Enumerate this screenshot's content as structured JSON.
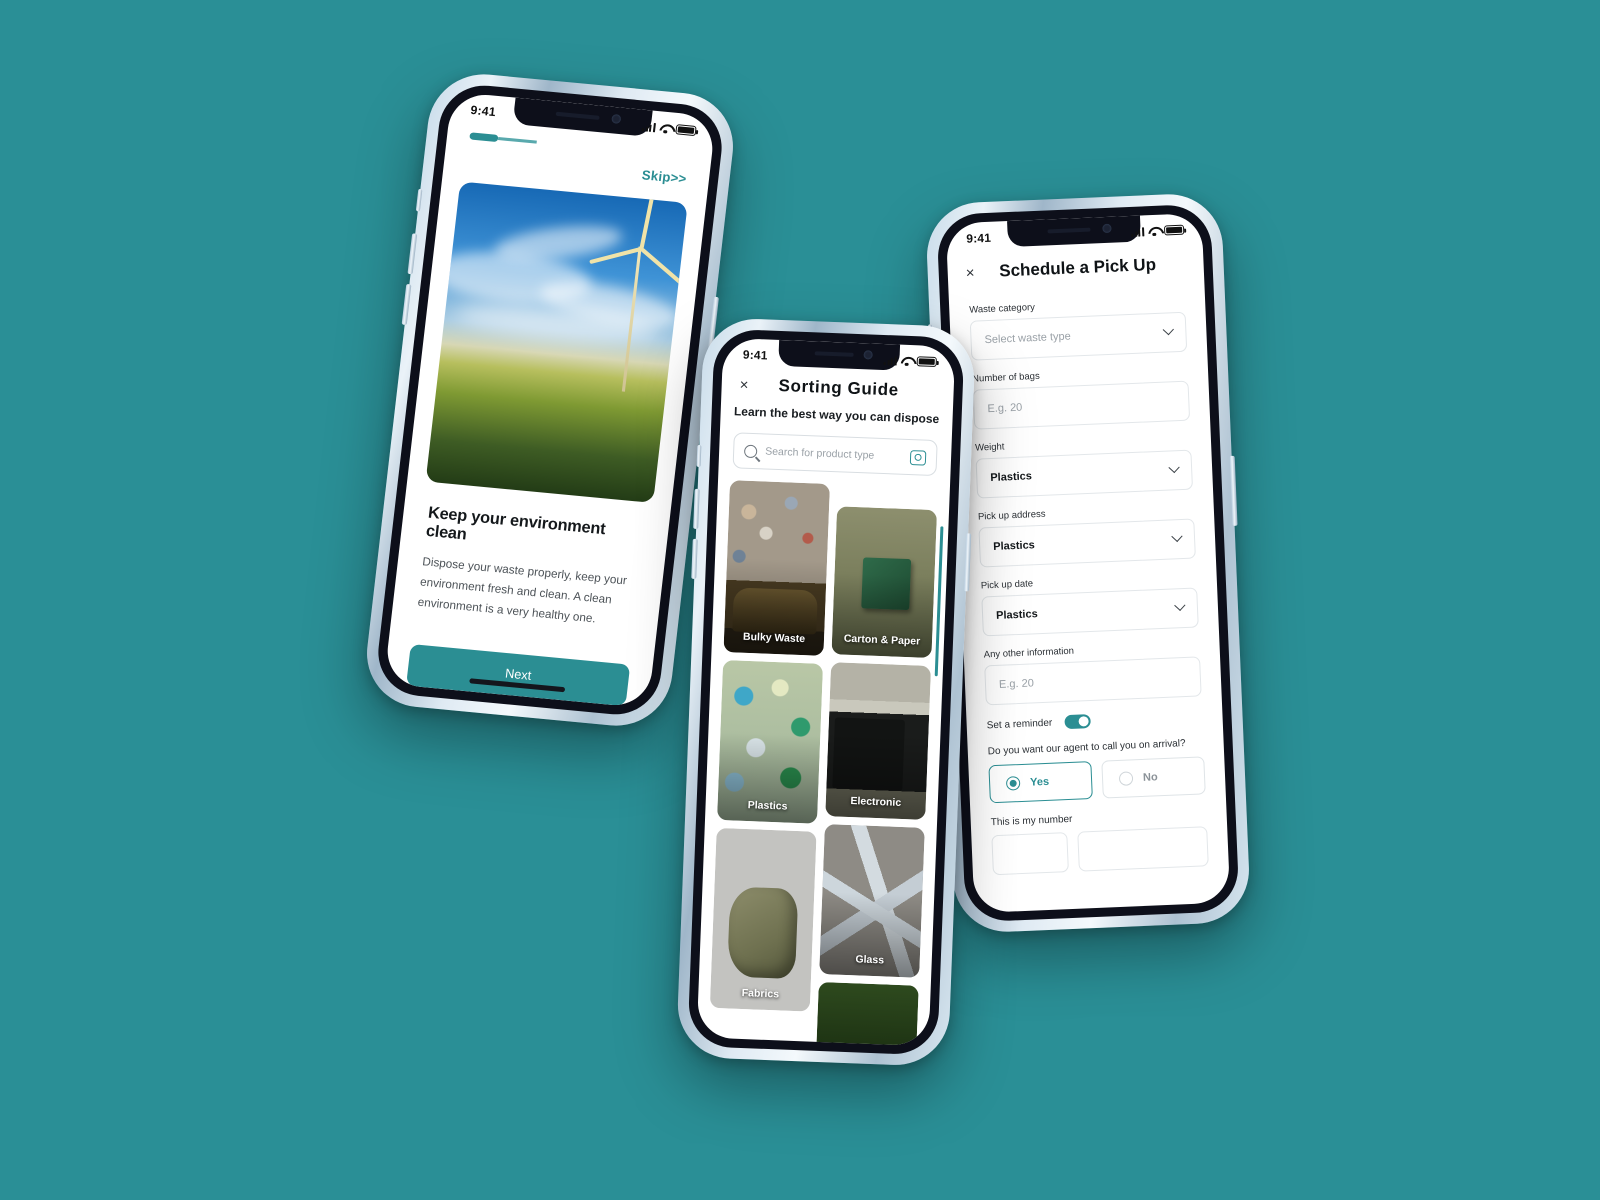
{
  "canvas": {
    "background_color": "#2a8f96"
  },
  "phones": {
    "onboarding": {
      "status": {
        "time": "9:41"
      },
      "skip_label": "Skip>>",
      "hero_alt": "sunflower-field-wind-turbine",
      "title": "Keep your environment clean",
      "description": "Dispose your waste properly, keep your environment fresh and clean. A clean environment is a very healthy one.",
      "next_label": "Next"
    },
    "sorting_guide": {
      "status": {
        "time": "9:41"
      },
      "close_label": "×",
      "title": "Sorting  Guide",
      "subtitle": "Learn the best way you can dispose",
      "search": {
        "placeholder": "Search for product type"
      },
      "tiles_left": [
        {
          "label": "Bulky Waste",
          "art": "art-bulky"
        },
        {
          "label": "Plastics",
          "art": "art-plastics"
        },
        {
          "label": "Fabrics",
          "art": "art-fabrics"
        }
      ],
      "tiles_right": [
        {
          "label": "Carton & Paper",
          "art": "art-carton"
        },
        {
          "label": "Electronic",
          "art": "art-electronic"
        },
        {
          "label": "Glass",
          "art": "art-glass"
        },
        {
          "label": "",
          "art": "art-grass"
        }
      ]
    },
    "schedule_pickup": {
      "status": {
        "time": "9:41"
      },
      "close_label": "×",
      "title": "Schedule a Pick Up",
      "fields": [
        {
          "label": "Waste category",
          "value": "",
          "placeholder": "Select waste type",
          "type": "select"
        },
        {
          "label": "Number of bags",
          "value": "",
          "placeholder": "E.g. 20",
          "type": "text"
        },
        {
          "label": "Weight",
          "value": "Plastics",
          "placeholder": "",
          "type": "select"
        },
        {
          "label": "Pick up address",
          "value": "Plastics",
          "placeholder": "",
          "type": "select"
        },
        {
          "label": "Pick up date",
          "value": "Plastics",
          "placeholder": "",
          "type": "select"
        },
        {
          "label": "Any other information",
          "value": "",
          "placeholder": "E.g. 20",
          "type": "text"
        }
      ],
      "reminder": {
        "label": "Set a reminder",
        "enabled": true
      },
      "agent_question": "Do you want our agent to call you on arrival?",
      "radio_yes": "Yes",
      "radio_no": "No",
      "number_label": "This is my number"
    }
  },
  "theme": {
    "accent": "#2b8e93",
    "text_dark": "#13171a",
    "text_muted": "#9aa1a7"
  }
}
